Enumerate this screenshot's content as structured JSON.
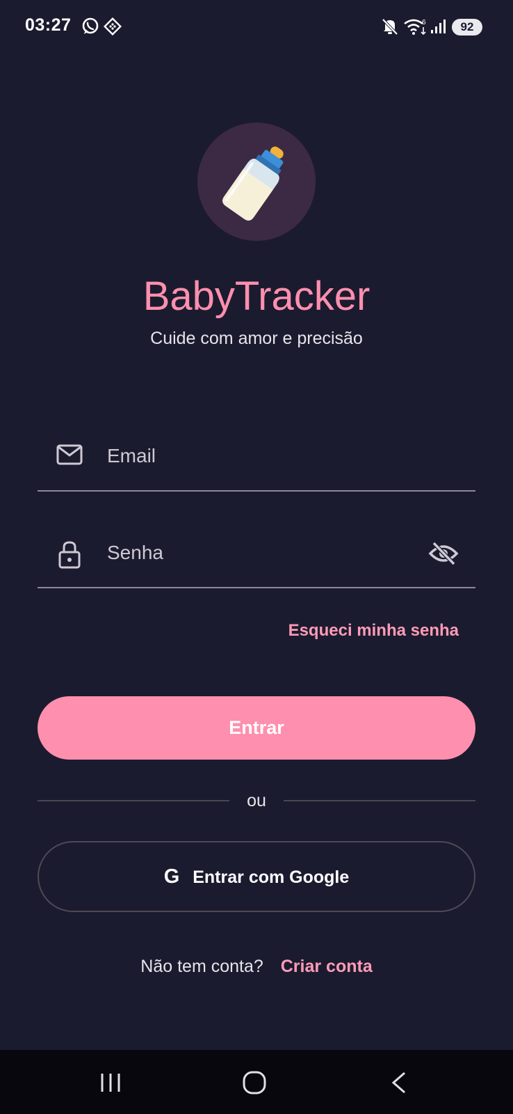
{
  "status_bar": {
    "time": "03:27",
    "battery": "92",
    "icons": [
      "whatsapp-icon",
      "app-notification-icon",
      "mute-icon",
      "wifi-icon",
      "signal-icon",
      "battery-icon"
    ]
  },
  "app": {
    "logo_icon": "baby-bottle-icon",
    "title": "BabyTracker",
    "subtitle": "Cuide com amor e precisão"
  },
  "form": {
    "email_placeholder": "Email",
    "email_value": "",
    "password_placeholder": "Senha",
    "password_value": "",
    "forgot_password": "Esqueci minha senha",
    "submit": "Entrar",
    "divider": "ou",
    "google_icon_letter": "G",
    "google_button": "Entrar com Google"
  },
  "signup": {
    "question": "Não tem conta?",
    "link": "Criar conta"
  },
  "colors": {
    "background": "#1b1b2f",
    "accent": "#ff8fae",
    "logo_bg": "#3c2a44"
  },
  "nav_bar": {
    "buttons": [
      "recent-apps-icon",
      "home-icon",
      "back-icon"
    ]
  }
}
